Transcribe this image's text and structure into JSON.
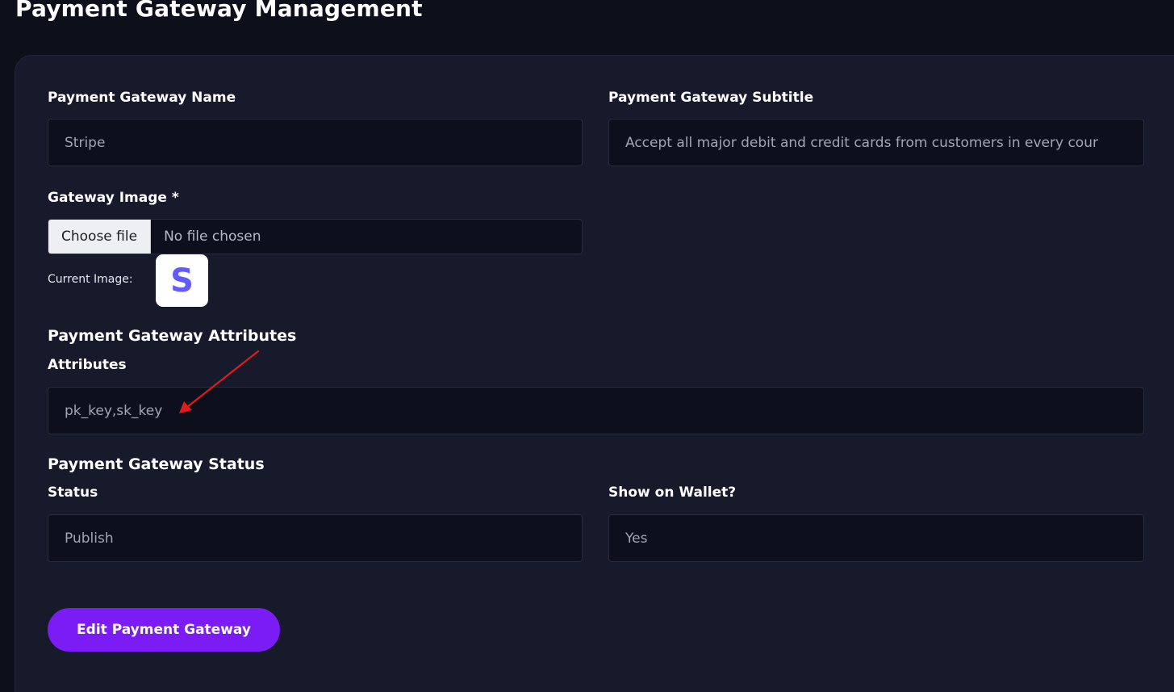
{
  "page": {
    "title": "Payment Gateway Management"
  },
  "form": {
    "name": {
      "label": "Payment Gateway Name",
      "value": "Stripe"
    },
    "subtitle": {
      "label": "Payment Gateway Subtitle",
      "value": "Accept all major debit and credit cards from customers in every cour"
    },
    "image": {
      "label": "Gateway Image *",
      "choose_file": "Choose file",
      "file_status": "No file chosen",
      "current_label": "Current Image:",
      "current_logo_letter": "S"
    },
    "attributes_section": "Payment Gateway Attributes",
    "attributes": {
      "label": "Attributes",
      "value": "pk_key,sk_key"
    },
    "status_section": "Payment Gateway Status",
    "status": {
      "label": "Status",
      "value": "Publish"
    },
    "wallet": {
      "label": "Show on Wallet?",
      "value": "Yes"
    },
    "submit": "Edit Payment Gateway"
  },
  "colors": {
    "background": "#0d0f1a",
    "card": "#171a2b",
    "input": "#0e0f1c",
    "accent": "#7c1cf4",
    "stripe_brand": "#635bff",
    "annotation_arrow": "#e01b1b"
  },
  "annotation": {
    "type": "arrow",
    "points_to": "attributes-input"
  }
}
